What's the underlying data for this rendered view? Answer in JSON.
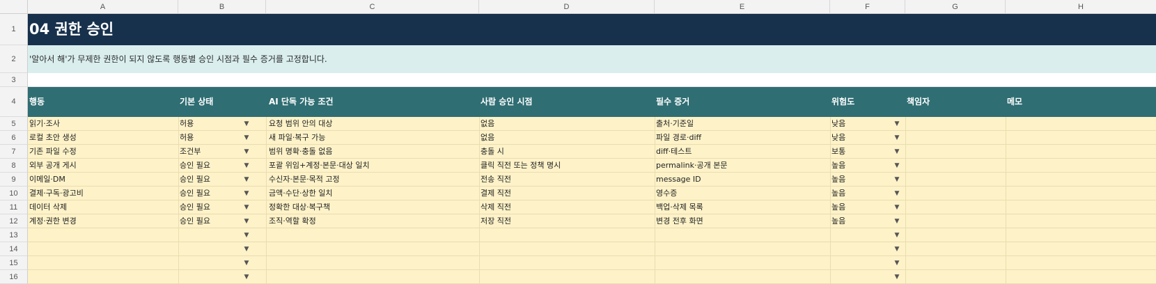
{
  "columns": [
    "A",
    "B",
    "C",
    "D",
    "E",
    "F",
    "G",
    "H"
  ],
  "row_numbers": [
    "1",
    "2",
    "3",
    "4",
    "5",
    "6",
    "7",
    "8",
    "9",
    "10",
    "11",
    "12",
    "13",
    "14",
    "15",
    "16"
  ],
  "title": "04 권한 승인",
  "subtitle": "'알아서 해'가 무제한 권한이 되지 않도록 행동별 승인 시점과 필수 증거를 고정합니다.",
  "headers": {
    "action": "행동",
    "default": "기본 상태",
    "ai_condition": "AI 단독 가능 조건",
    "approval_time": "사람 승인 시점",
    "evidence": "필수 증거",
    "risk": "위험도",
    "owner": "책임자",
    "memo": "메모"
  },
  "dropdown_glyph": "▼",
  "rows": [
    {
      "action": "읽기·조사",
      "default": "허용",
      "ai_condition": "요청 범위 안의 대상",
      "approval_time": "없음",
      "evidence": "출처·기준일",
      "risk": "낮음",
      "owner": "",
      "memo": ""
    },
    {
      "action": "로컬 초안 생성",
      "default": "허용",
      "ai_condition": "새 파일·복구 가능",
      "approval_time": "없음",
      "evidence": "파일 경로·diff",
      "risk": "낮음",
      "owner": "",
      "memo": ""
    },
    {
      "action": "기존 파일 수정",
      "default": "조건부",
      "ai_condition": "범위 명확·충돌 없음",
      "approval_time": "충돌 시",
      "evidence": "diff·테스트",
      "risk": "보통",
      "owner": "",
      "memo": ""
    },
    {
      "action": "외부 공개 게시",
      "default": "승인 필요",
      "ai_condition": "포괄 위임+계정·본문·대상 일치",
      "approval_time": "클릭 직전 또는 정책 명시",
      "evidence": "permalink·공개 본문",
      "risk": "높음",
      "owner": "",
      "memo": ""
    },
    {
      "action": "이메일·DM",
      "default": "승인 필요",
      "ai_condition": "수신자·본문·목적 고정",
      "approval_time": "전송 직전",
      "evidence": "message ID",
      "risk": "높음",
      "owner": "",
      "memo": ""
    },
    {
      "action": "결제·구독·광고비",
      "default": "승인 필요",
      "ai_condition": "금액·수단·상한 일치",
      "approval_time": "결제 직전",
      "evidence": "영수증",
      "risk": "높음",
      "owner": "",
      "memo": ""
    },
    {
      "action": "데이터 삭제",
      "default": "승인 필요",
      "ai_condition": "정확한 대상·복구책",
      "approval_time": "삭제 직전",
      "evidence": "백업·삭제 목록",
      "risk": "높음",
      "owner": "",
      "memo": ""
    },
    {
      "action": "계정·권한 변경",
      "default": "승인 필요",
      "ai_condition": "조직·역할 확정",
      "approval_time": "저장 직전",
      "evidence": "변경 전후 화면",
      "risk": "높음",
      "owner": "",
      "memo": ""
    },
    {
      "action": "",
      "default": "",
      "ai_condition": "",
      "approval_time": "",
      "evidence": "",
      "risk": "",
      "owner": "",
      "memo": ""
    },
    {
      "action": "",
      "default": "",
      "ai_condition": "",
      "approval_time": "",
      "evidence": "",
      "risk": "",
      "owner": "",
      "memo": ""
    },
    {
      "action": "",
      "default": "",
      "ai_condition": "",
      "approval_time": "",
      "evidence": "",
      "risk": "",
      "owner": "",
      "memo": ""
    },
    {
      "action": "",
      "default": "",
      "ai_condition": "",
      "approval_time": "",
      "evidence": "",
      "risk": "",
      "owner": "",
      "memo": ""
    }
  ]
}
